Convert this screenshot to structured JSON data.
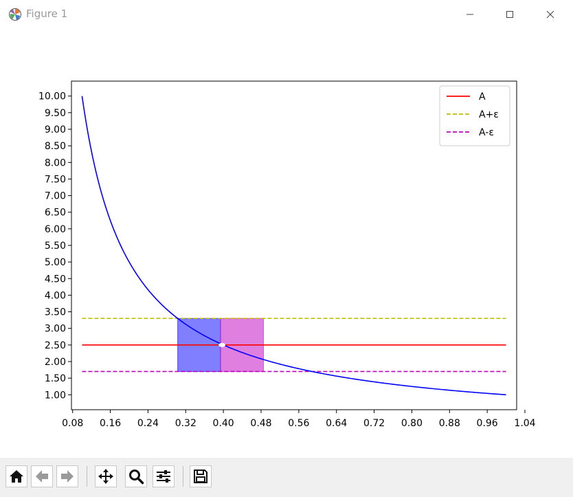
{
  "window": {
    "title": "Figure 1"
  },
  "toolbar": {
    "buttons": [
      {
        "name": "home-button",
        "icon": "home-icon"
      },
      {
        "name": "back-button",
        "icon": "arrow-left-icon"
      },
      {
        "name": "forward-button",
        "icon": "arrow-right-icon"
      },
      {
        "name": "pan-button",
        "icon": "move-icon"
      },
      {
        "name": "zoom-button",
        "icon": "magnifier-icon"
      },
      {
        "name": "configure-subplots-button",
        "icon": "sliders-icon"
      },
      {
        "name": "save-button",
        "icon": "floppy-disk-icon"
      }
    ]
  },
  "chart_data": {
    "type": "line",
    "title": "",
    "xlabel": "",
    "ylabel": "",
    "xlim": [
      0.0775,
      1.0225
    ],
    "ylim": [
      0.55,
      10.45
    ],
    "xticks": [
      0.08,
      0.16,
      0.24,
      0.32,
      0.4,
      0.48,
      0.56,
      0.64,
      0.72,
      0.8,
      0.88,
      0.96,
      1.04
    ],
    "xtick_labels": [
      "0.08",
      "0.16",
      "0.24",
      "0.32",
      "0.40",
      "0.48",
      "0.56",
      "0.64",
      "0.72",
      "0.80",
      "0.88",
      "0.96",
      "1.04"
    ],
    "yticks": [
      1.0,
      1.5,
      2.0,
      2.5,
      3.0,
      3.5,
      4.0,
      4.5,
      5.0,
      5.5,
      6.0,
      6.5,
      7.0,
      7.5,
      8.0,
      8.5,
      9.0,
      9.5,
      10.0
    ],
    "ytick_labels": [
      "1.00",
      "1.50",
      "2.00",
      "2.50",
      "3.00",
      "3.50",
      "4.00",
      "4.50",
      "5.00",
      "5.50",
      "6.00",
      "6.50",
      "7.00",
      "7.50",
      "8.00",
      "8.50",
      "9.00",
      "9.50",
      "10.00"
    ],
    "grid": false,
    "legend_position": "upper right",
    "curve": {
      "function": "y = 1/x",
      "x_range": [
        0.1,
        1.0
      ],
      "color": "#0000ff"
    },
    "series": [
      {
        "name": "A",
        "y": 2.5,
        "x": [
          0.1,
          1.0
        ],
        "color": "#ff0000",
        "style": "solid"
      },
      {
        "name": "A+ε",
        "y": 3.3,
        "x": [
          0.1,
          1.0
        ],
        "color": "#bfbf00",
        "style": "dashed"
      },
      {
        "name": "A-ε",
        "y": 1.7,
        "x": [
          0.1,
          1.0
        ],
        "color": "#bf00bf",
        "style": "dashed"
      }
    ],
    "spans": [
      {
        "x": [
          0.303,
          0.394
        ],
        "y": [
          1.7,
          3.3
        ],
        "color": "#0000ff",
        "alpha": 0.5
      },
      {
        "x": [
          0.394,
          0.485
        ],
        "y": [
          1.7,
          3.3
        ],
        "color": "#bf00bf",
        "alpha": 0.5
      }
    ],
    "marker": {
      "x": 0.4,
      "y": 2.5,
      "color": "#ffffff"
    }
  }
}
